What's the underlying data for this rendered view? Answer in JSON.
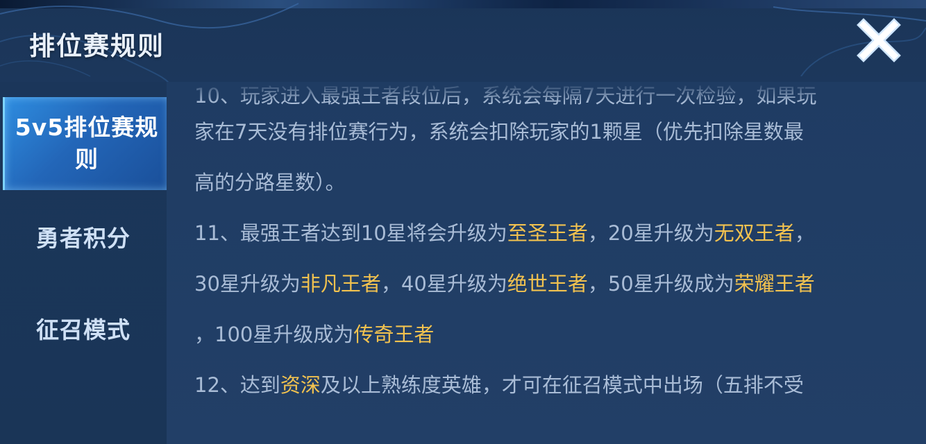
{
  "header": {
    "title": "排位赛规则",
    "close_icon": "close-x-icon"
  },
  "sidebar": {
    "items": [
      {
        "label_line1": "5v5排位赛规",
        "label_line2": "则",
        "active": true
      },
      {
        "label": "勇者积分",
        "active": false
      },
      {
        "label": "征召模式",
        "active": false
      }
    ]
  },
  "content": {
    "rule10": {
      "line1": "10、玩家进入最强王者段位后，系统会每隔7天进行一次检验，如果玩",
      "line2": "家在7天没有排位赛行为，系统会扣除玩家的1颗星（优先扣除星数最",
      "line3": "高的分路星数）。"
    },
    "rule11": {
      "l1_a": "11、最强王者达到10星将会升级为",
      "l1_hl1": "至圣王者",
      "l1_b": "，20星升级为",
      "l1_hl2": "无双王者",
      "l1_c": "，",
      "l2_a": "30星升级为",
      "l2_hl1": "非凡王者",
      "l2_b": "，40星升级为",
      "l2_hl2": "绝世王者",
      "l2_c": "，50星升级成为",
      "l2_hl3": "荣耀王者",
      "l3_a": "，100星升级成为",
      "l3_hl1": "传奇王者"
    },
    "rule12": {
      "l1_a": "12、达到",
      "l1_hl1": "资深",
      "l1_b": "及以上熟练度英雄，才可在征召模式中出场（五排不受"
    }
  },
  "colors": {
    "highlight": "#f2c24f",
    "text": "#a9bcd6",
    "active_tab": "#2a78cf"
  }
}
